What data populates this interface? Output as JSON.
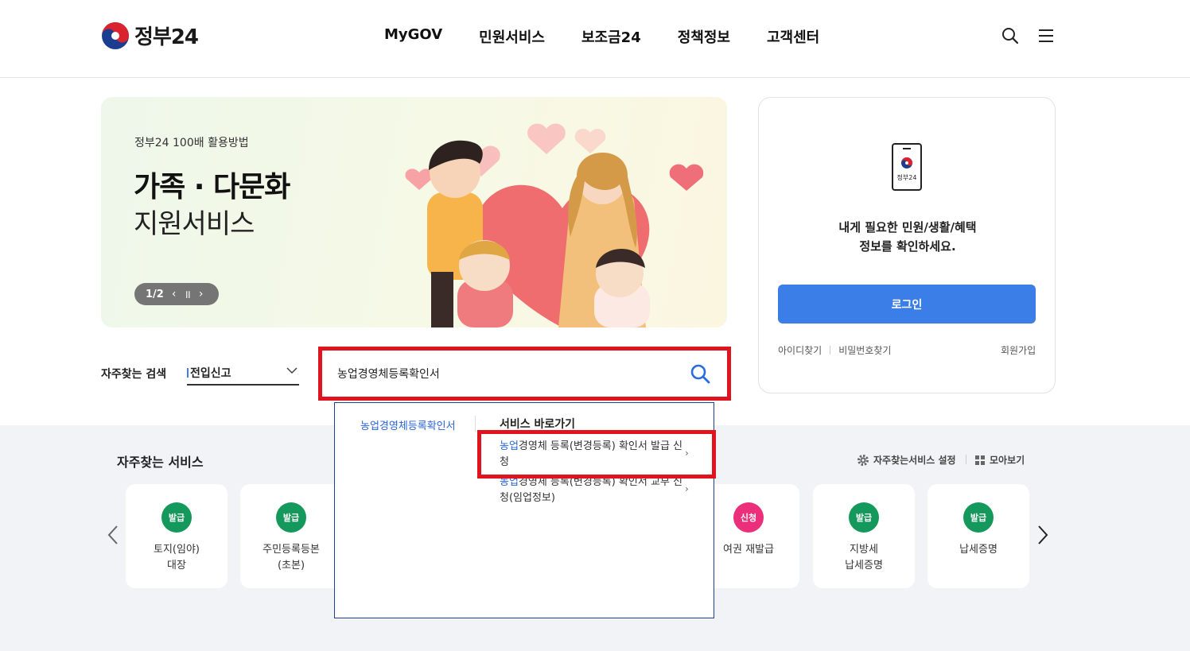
{
  "header": {
    "logo_text": "정부24",
    "nav": [
      "MyGOV",
      "민원서비스",
      "보조금24",
      "정책정보",
      "고객센터"
    ]
  },
  "banner": {
    "kicker": "정부24 100배 활용방법",
    "title": "가족 · 다문화",
    "subtitle": "지원서비스",
    "pager": "1/2"
  },
  "login": {
    "phone_label": "정부24",
    "message_line1": "내게 필요한 민원/생활/혜택",
    "message_line2": "정보를 확인하세요.",
    "button": "로그인",
    "find_id": "아이디찾기",
    "find_pw": "비밀번호찾기",
    "join": "회원가입"
  },
  "search": {
    "freq_label": "자주찾는 검색",
    "freq_selected": "전입신고",
    "query": "농업경영체등록확인서"
  },
  "autocomplete": {
    "keyword": "농업경영체등록확인서",
    "heading": "서비스 바로가기",
    "items": [
      {
        "hl": "농업",
        "rest_line1": "경영체 등록(변경등록) 확인서 발급 신",
        "rest_line2": "청"
      },
      {
        "hl": "농업",
        "rest_line1": "경영체 등록(변경등록) 확인서 교부 신",
        "rest_line2": "청(임업정보)"
      }
    ]
  },
  "services": {
    "title": "자주찾는 서비스",
    "setting": "자주찾는서비스 설정",
    "view_all": "모아보기",
    "cards": [
      {
        "badge": "발급",
        "line1": "토지(임야)",
        "line2": "대장"
      },
      {
        "badge": "발급",
        "line1": "주민등록등본",
        "line2": "(초본)"
      },
      {
        "badge": "신청",
        "line1": "여권 재발급",
        "line2": ""
      },
      {
        "badge": "발급",
        "line1": "지방세",
        "line2": "납세증명"
      },
      {
        "badge": "발급",
        "line1": "납세증명",
        "line2": ""
      }
    ]
  },
  "colors": {
    "accent_blue": "#3b7ee8",
    "badge_green": "#14985b",
    "badge_pink": "#ec2f7a",
    "highlight_red": "#e0141e"
  }
}
